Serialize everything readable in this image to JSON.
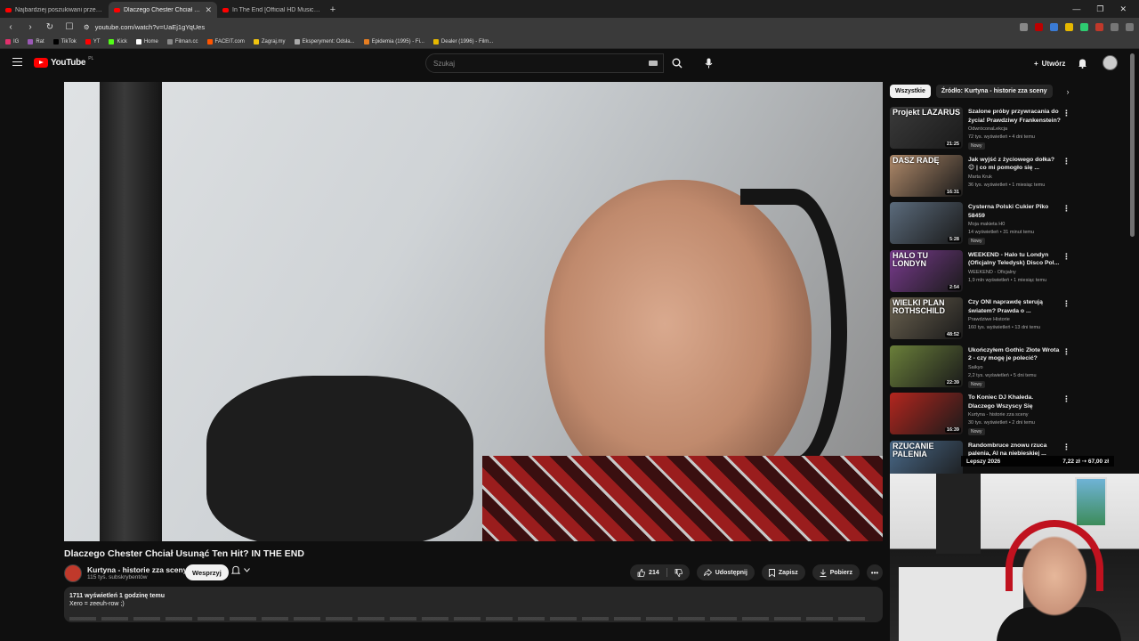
{
  "browser": {
    "tabs": [
      {
        "title": "Najbardziej poszukiwani przestępcy",
        "active": false
      },
      {
        "title": "Dlaczego Chester Chciał Usunąć",
        "active": true
      },
      {
        "title": "In The End [Official HD Music Video]",
        "active": false
      }
    ],
    "url": "youtube.com/watch?v=UaEj1gYqUes",
    "bookmarks": [
      {
        "label": "IG",
        "color": "#e1306c"
      },
      {
        "label": "Rat",
        "color": "#9b59b6"
      },
      {
        "label": "TikTok",
        "color": "#000000"
      },
      {
        "label": "YT",
        "color": "#ff0000"
      },
      {
        "label": "Kick",
        "color": "#53fc18"
      },
      {
        "label": "Home",
        "color": "#ffffff"
      },
      {
        "label": "Filman.cc",
        "color": "#888888"
      },
      {
        "label": "FACEIT.com",
        "color": "#ff5500"
      },
      {
        "label": "Zagraj.my",
        "color": "#f1c40f"
      },
      {
        "label": "Eksperyment: Odsła...",
        "color": "#aaaaaa"
      },
      {
        "label": "Epidemia (1995) - Fi...",
        "color": "#e67e22"
      },
      {
        "label": "Dealer (1996) - Film...",
        "color": "#e6b800"
      }
    ]
  },
  "header": {
    "logo_text": "YouTube",
    "country": "PL",
    "search_placeholder": "Szukaj",
    "create_label": "Utwórz"
  },
  "video": {
    "title": "Dlaczego Chester Chciał Usunąć Ten Hit? IN THE END",
    "channel": "Kurtyna - historie zza sceny",
    "subscribers": "115 tys. subskrybentów",
    "support_label": "Wesprzyj",
    "likes": "214",
    "share_label": "Udostępnij",
    "save_label": "Zapisz",
    "download_label": "Pobierz",
    "views_time": "1711 wyświetleń  1 godzinę temu",
    "description": "Xero = zeeuh-row ;)"
  },
  "chips": {
    "all": "Wszystkie",
    "source": "Źródło: Kurtyna - historie zza sceny"
  },
  "recommendations": [
    {
      "title": "Szalone próby przywracania do życia! Prawdziwy Frankenstein?",
      "channel": "OdwróconaLekcja",
      "meta": "72 tys. wyświetleń • 4 dni temu",
      "badge": "Nowy",
      "duration": "21:25",
      "thumb_text": "Projekt LAZARUS",
      "color": "#3a3a3a"
    },
    {
      "title": "Jak wyjść z życiowego dołka? 😊 | co mi pomogło się ...",
      "channel": "Marta Kruk",
      "meta": "36 tys. wyświetleń • 1 miesiąc temu",
      "badge": "",
      "duration": "16:31",
      "thumb_text": "DASZ RADĘ",
      "color": "#b08a6a"
    },
    {
      "title": "Cysterna Polski Cukier Pîko 58459",
      "channel": "Moja makieta H0",
      "meta": "14 wyświetleń • 31 minut temu",
      "badge": "Nowy",
      "duration": "5:28",
      "thumb_text": "",
      "color": "#5b6b7c"
    },
    {
      "title": "WEEKEND - Halo tu Londyn (Oficjalny Teledysk) Disco Pol...",
      "channel": "WEEKEND - Oficjalny",
      "meta": "1,9 mln wyświetleń • 1 miesiąc temu",
      "badge": "",
      "duration": "2:54",
      "thumb_text": "HALO TU LONDYN",
      "color": "#7a3b8f"
    },
    {
      "title": "Czy ONI naprawdę sterują światem? Prawda o ...",
      "channel": "Prawdziwe Historie",
      "meta": "160 tys. wyświetleń • 13 dni temu",
      "badge": "",
      "duration": "48:52",
      "thumb_text": "WIELKI PLAN ROTHSCHILD",
      "color": "#6b6250"
    },
    {
      "title": "Ukończyłem Gothic Złote Wrota 2 - czy mogę je polecić?",
      "channel": "Saikyo",
      "meta": "2,2 tys. wyświetleń • 5 dni temu",
      "badge": "Nowy",
      "duration": "22:39",
      "thumb_text": "",
      "color": "#6a7f3a"
    },
    {
      "title": "To Koniec DJ Khaleda. Dlaczego Wszyscy Się Odwrócili?",
      "channel": "Kurtyna - historie zza sceny",
      "meta": "30 tys. wyświetleń • 2 dni temu",
      "badge": "Nowy",
      "duration": "16:39",
      "thumb_text": "",
      "color": "#b3261e"
    },
    {
      "title": "Randombruce znowu rzuca palenia, AI na niebieskiej ...",
      "channel": "",
      "meta": "",
      "badge": "",
      "duration": "30:47",
      "thumb_text": "RZUCANIE PALENIA",
      "color": "#4a6a8a"
    }
  ],
  "overlay": {
    "left": "Lepszy 2026",
    "right": "7,22 zł ⇢ 67,00 zł"
  }
}
